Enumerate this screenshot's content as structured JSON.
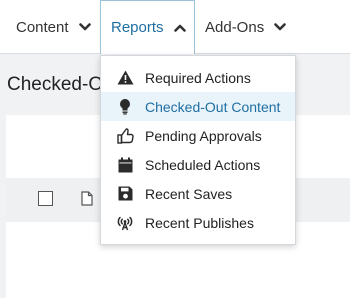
{
  "nav": {
    "items": [
      {
        "label": "Content",
        "icon": "chevron-down-icon"
      },
      {
        "label": "Reports",
        "icon": "chevron-up-icon",
        "active": true
      },
      {
        "label": "Add-Ons",
        "icon": "chevron-down-icon"
      }
    ],
    "active_color": "#1f6fa3"
  },
  "page": {
    "title": "Checked-O"
  },
  "reports_menu": {
    "items": [
      {
        "label": "Required Actions",
        "icon": "warning-icon"
      },
      {
        "label": "Checked-Out Content",
        "icon": "lightbulb-icon",
        "highlighted": true
      },
      {
        "label": "Pending Approvals",
        "icon": "thumbs-up-icon"
      },
      {
        "label": "Scheduled Actions",
        "icon": "calendar-icon"
      },
      {
        "label": "Recent Saves",
        "icon": "save-icon"
      },
      {
        "label": "Recent Publishes",
        "icon": "broadcast-icon"
      }
    ],
    "highlight_bg": "#e9f3fa"
  },
  "table": {
    "row_icons": [
      "checkbox",
      "file-icon"
    ]
  }
}
